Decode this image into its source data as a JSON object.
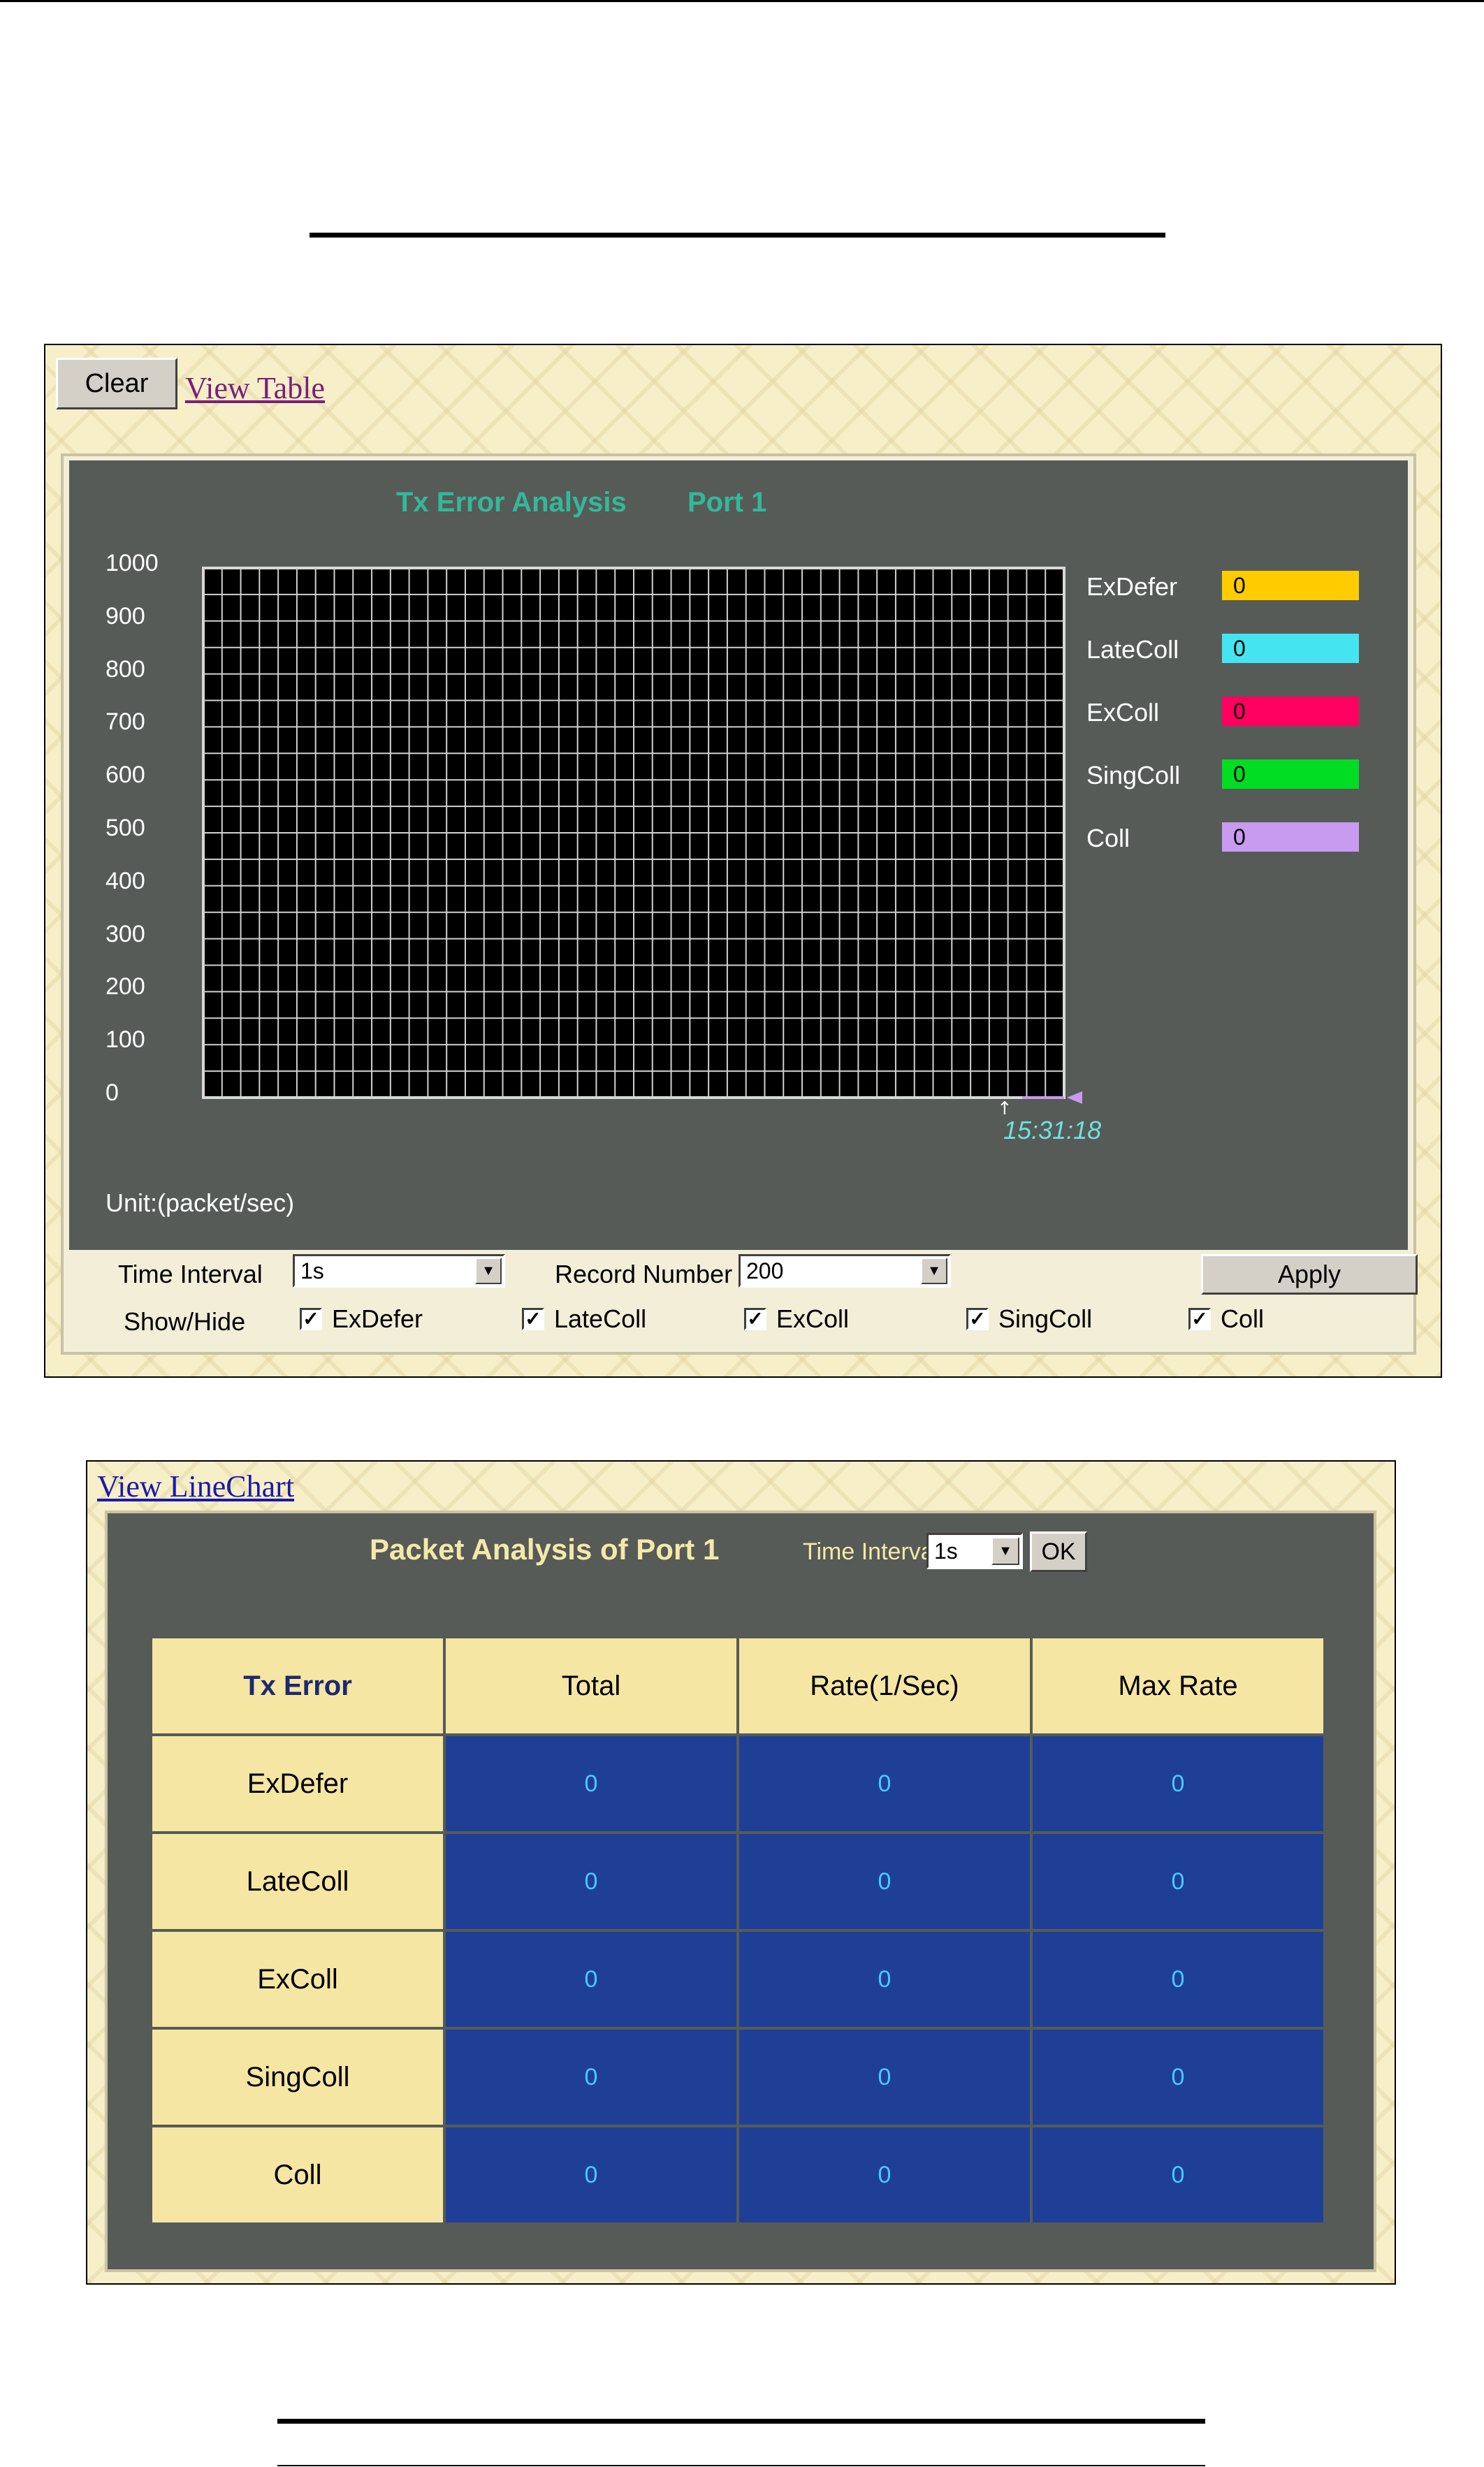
{
  "chart_panel": {
    "clear_label": "Clear",
    "view_table_label": "View Table",
    "title_left": "Tx Error Analysis",
    "title_right": "Port 1",
    "unit": "Unit:(packet/sec)",
    "time_readout": "15:31:18",
    "legend": [
      {
        "name": "ExDefer",
        "value": "0",
        "color": "#ffcc00"
      },
      {
        "name": "LateColl",
        "value": "0",
        "color": "#44e4f0"
      },
      {
        "name": "ExColl",
        "value": "0",
        "color": "#ff0060"
      },
      {
        "name": "SingColl",
        "value": "0",
        "color": "#00dd22"
      },
      {
        "name": "Coll",
        "value": "0",
        "color": "#c89af0"
      }
    ],
    "controls": {
      "time_interval_label": "Time Interval",
      "time_interval_value": "1s",
      "record_number_label": "Record Number",
      "record_number_value": "200",
      "apply_label": "Apply",
      "show_hide_label": "Show/Hide",
      "checkboxes": [
        {
          "label": "ExDefer",
          "checked": true
        },
        {
          "label": "LateColl",
          "checked": true
        },
        {
          "label": "ExColl",
          "checked": true
        },
        {
          "label": "SingColl",
          "checked": true
        },
        {
          "label": "Coll",
          "checked": true
        }
      ]
    }
  },
  "chart_data": {
    "type": "line",
    "title": "Tx Error Analysis   Port 1",
    "ylabel": "Unit:(packet/sec)",
    "ylim": [
      0,
      1000
    ],
    "yticks": [
      "1000",
      "900",
      "800",
      "700",
      "600",
      "500",
      "400",
      "300",
      "200",
      "100",
      "0"
    ],
    "grid": true,
    "legend_position": "right",
    "series": [
      {
        "name": "ExDefer",
        "values": [
          0
        ]
      },
      {
        "name": "LateColl",
        "values": [
          0
        ]
      },
      {
        "name": "ExColl",
        "values": [
          0
        ]
      },
      {
        "name": "SingColl",
        "values": [
          0
        ]
      },
      {
        "name": "Coll",
        "values": [
          0
        ]
      }
    ],
    "x": [
      "15:31:18"
    ]
  },
  "table_panel": {
    "view_linechart_label": "View LineChart",
    "title": "Packet Analysis of Port 1",
    "time_interval_label": "Time Interval",
    "time_interval_value": "1s",
    "ok_label": "OK",
    "headers": [
      "Tx Error",
      "Total",
      "Rate(1/Sec)",
      "Max Rate"
    ],
    "rows": [
      {
        "name": "ExDefer",
        "total": "0",
        "rate": "0",
        "max": "0"
      },
      {
        "name": "LateColl",
        "total": "0",
        "rate": "0",
        "max": "0"
      },
      {
        "name": "ExColl",
        "total": "0",
        "rate": "0",
        "max": "0"
      },
      {
        "name": "SingColl",
        "total": "0",
        "rate": "0",
        "max": "0"
      },
      {
        "name": "Coll",
        "total": "0",
        "rate": "0",
        "max": "0"
      }
    ]
  }
}
